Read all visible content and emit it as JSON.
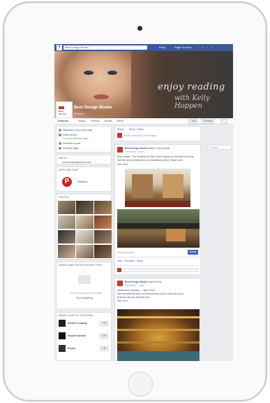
{
  "topbar": {
    "logo": "f",
    "search_value": "Best Design Books",
    "user": "Kelly",
    "nav_label": "Page Home",
    "nav_chevron": "▾",
    "icon_glyphs": "• • • •"
  },
  "cover": {
    "headline": "enjoy reading",
    "signature": "with Kelly Hoppen",
    "profile_label": "BEST DESIGN"
  },
  "page": {
    "name": "Best Design Books",
    "category": "Website"
  },
  "tabs": {
    "items": [
      "Timeline",
      "About",
      "Photos",
      "Books",
      "More"
    ],
    "liked": "Liked",
    "message": "Message",
    "more": "···"
  },
  "left": {
    "checklist": [
      "Welcome to your new page",
      "Invite friends",
      "Promote your page",
      "Schedule a post",
      "Promote Page"
    ],
    "checklist_sub": "Promote Website Page",
    "about_title": "ABOUT",
    "about_link": "www.bestdesignbooks.com",
    "apps_title": "APPS AND TABS",
    "apps_item": "Pinterest",
    "photos_title": "PHOTOS",
    "videos_title": "VIDEOS AND PHOTOS PEOPLE POST",
    "videos_text": "No recent posts on this Page",
    "videos_link": "Post something",
    "pages_title": "PAGES LIKED BY THIS PAGE",
    "pages": [
      {
        "name": "Kindle E-reading",
        "btn": "Like"
      },
      {
        "name": "Russell Garbett",
        "btn": "Like"
      },
      {
        "name": "Studio",
        "btn": "Like"
      }
    ]
  },
  "feed": {
    "composer_tabs": [
      "Status",
      "Photo / Video"
    ],
    "composer_placeholder": "Write something on this Page...",
    "post1": {
      "author": "Best Design Books",
      "action": "added 2 new photos",
      "meta": "Published · 16 hrs",
      "text_a": "Book review: The Pavilions at Oak Creek Canyon by Sir Neal & friends",
      "text_b": "see the new architecture for a residential project. Read more",
      "see_more": "See more",
      "likes": "Like · Comment · Share",
      "people_reached": "People reached",
      "boost": "Boost"
    },
    "post2": {
      "author": "Best Design Books",
      "action": "shared a link",
      "meta": "Published · 1 day",
      "text_a": "Illuminated Libraries — Jake Finch",
      "text_b": "See beautiful libraries from around the world in this new book.",
      "text_c": "#Library #Books #Architecture",
      "see_more": "See more"
    }
  },
  "right": {
    "search_label": "Search"
  },
  "colors": {
    "fb_blue": "#3b5998",
    "link": "#365899",
    "text": "#4b4f56",
    "meta": "#90949c",
    "divider": "#dddfe2",
    "background": "#e9ebee",
    "pinterest": "#cb2027"
  }
}
